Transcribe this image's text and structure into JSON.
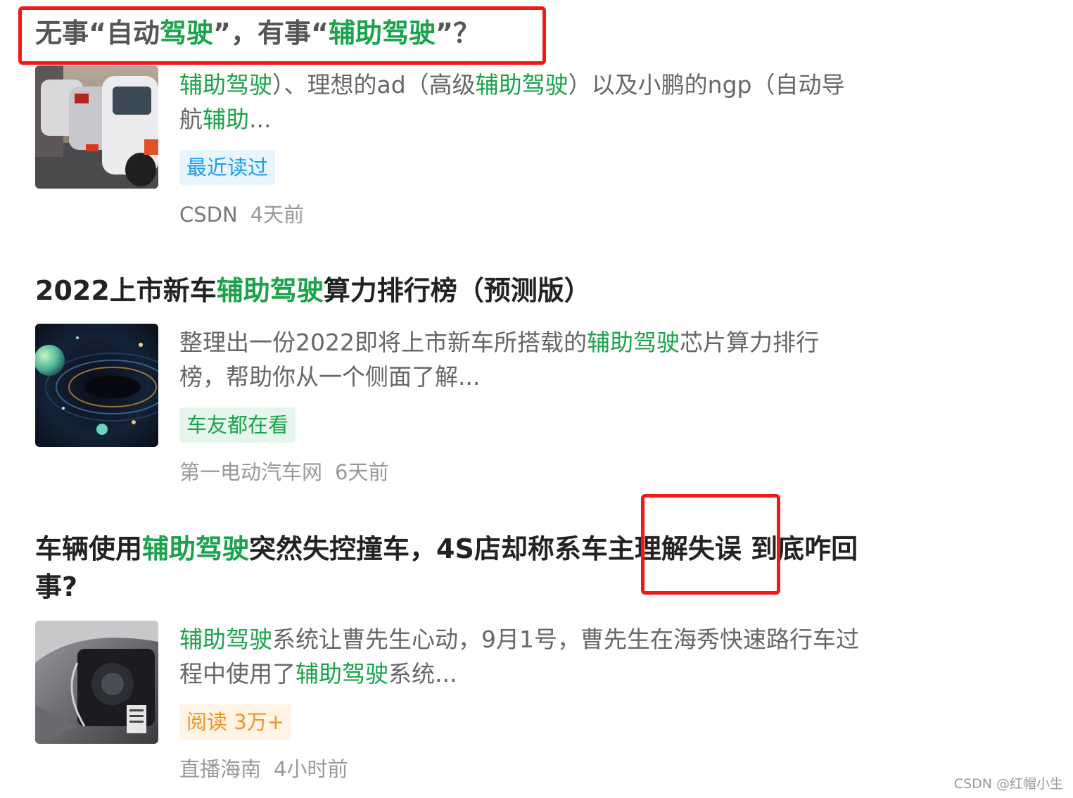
{
  "colors": {
    "highlight": "#1aa34a",
    "annotation_red": "#f21818"
  },
  "articles": [
    {
      "title_parts": [
        "无事“自动",
        "驾驶",
        "”，有事“",
        "辅助驾驶",
        "”？"
      ],
      "summary_parts": [
        "辅助驾驶",
        "）、理想的ad（高级",
        "辅助驾驶",
        "）以及小鹏的ngp（自动导航",
        "辅助",
        "..."
      ],
      "tag": "最近读过",
      "source": "CSDN",
      "time": "4天前",
      "thumb_icon": "traffic-jam-photo"
    },
    {
      "title_parts": [
        "2022上市新车",
        "辅助驾驶",
        "算力排行榜（预测版）"
      ],
      "summary_parts": [
        "整理出一份2022即将上市新车所搭载的",
        "辅助驾驶",
        "芯片算力排行榜，帮助你从一个侧面了解..."
      ],
      "tag": "车友都在看",
      "source": "第一电动汽车网",
      "time": "6天前",
      "thumb_icon": "galaxy-photo"
    },
    {
      "title_parts": [
        "车辆使用",
        "辅助驾驶",
        "突然失控撞车，4S店却称系车主理解失误 到底咋回事?"
      ],
      "summary_parts": [
        "辅助驾驶",
        "系统让曹先生心动，9月1号，曹先生在海秀快速路行车过程中使用了",
        "辅助驾驶",
        "系统..."
      ],
      "tag": "阅读 3万+",
      "source": "直播海南",
      "time": "4小时前",
      "thumb_icon": "damaged-headlight-photo"
    }
  ],
  "watermark": "CSDN @红帽小生"
}
